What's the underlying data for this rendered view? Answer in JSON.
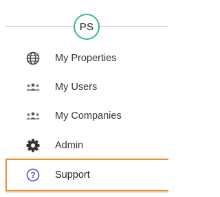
{
  "profile": {
    "initials": "PS"
  },
  "menu": {
    "items": [
      {
        "label": "My Properties",
        "icon": "globe-icon"
      },
      {
        "label": "My Users",
        "icon": "users-icon"
      },
      {
        "label": "My Companies",
        "icon": "users-icon"
      },
      {
        "label": "Admin",
        "icon": "gear-icon"
      },
      {
        "label": "Support",
        "icon": "help-icon",
        "selected": true
      }
    ]
  },
  "colors": {
    "avatar_border": "#34b78f",
    "selected_border": "#f08a2c",
    "help_icon": "#6a4fc8",
    "icon_gray": "#555555"
  }
}
